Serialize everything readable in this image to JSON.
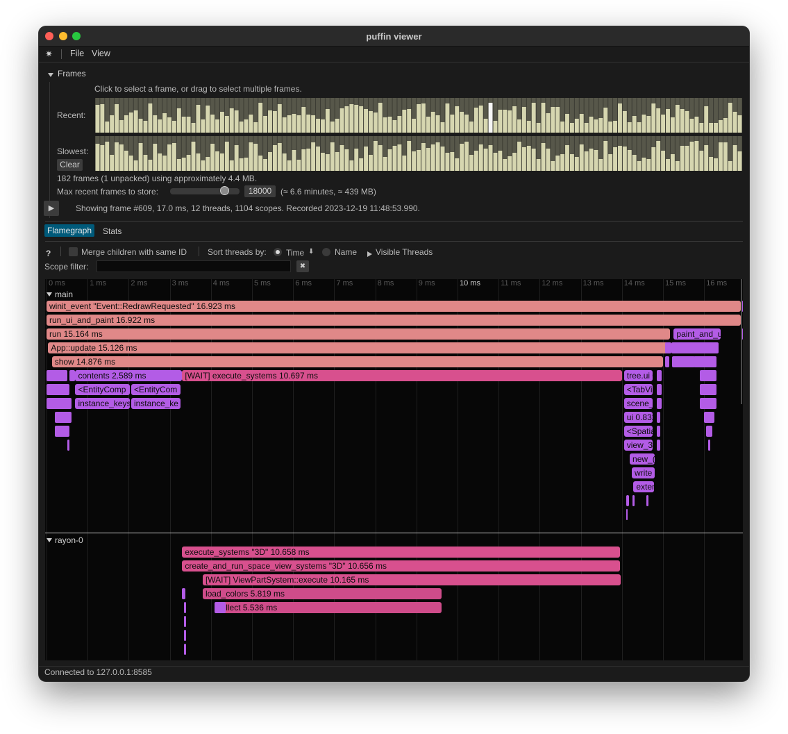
{
  "window": {
    "title": "puffin viewer"
  },
  "menu": {
    "logo": "✷",
    "file": "File",
    "view": "View"
  },
  "frames": {
    "header": "Frames",
    "hint": "Click to select a frame, or drag to select multiple frames.",
    "recent_label": "Recent:",
    "slowest_label": "Slowest:",
    "clear_label": "Clear",
    "summary": "182 frames (1 unpacked) using approximately 4.4 MB.",
    "max_label": "Max recent frames to store:",
    "max_value": "18000",
    "max_estimate": "(≈ 6.6 minutes, ≈ 439 MB)",
    "slider_fraction": 0.78,
    "play_icon": "▶",
    "status": "Showing frame #609, 17.0 ms, 12 threads, 1104 scopes. Recorded 2023-12-19 11:48:53.990."
  },
  "tabs": {
    "flamegraph": "Flamegraph",
    "stats": "Stats"
  },
  "options": {
    "help": "?",
    "merge_label": "Merge children with same ID",
    "sort_label": "Sort threads by:",
    "time_label": "Time",
    "sort_arrow": "⬇",
    "name_label": "Name",
    "visible_threads": "Visible Threads",
    "scope_filter_label": "Scope filter:",
    "clear_filter_icon": "✖"
  },
  "timeline": {
    "ticks": [
      "0 ms",
      "1 ms",
      "2 ms",
      "3 ms",
      "4 ms",
      "5 ms",
      "6 ms",
      "7 ms",
      "8 ms",
      "9 ms",
      "10 ms",
      "11 ms",
      "12 ms",
      "13 ms",
      "14 ms",
      "15 ms",
      "16 ms"
    ]
  },
  "threads": [
    {
      "name": "main",
      "scopes": [
        {
          "label": "winit_event \"Event::RedrawRequested\" 16.923 ms",
          "start": 0.0,
          "dur": 16.923,
          "depth": 0,
          "color": "#e08888"
        },
        {
          "label": "run_ui_and_paint 16.922 ms",
          "start": 0.0,
          "dur": 16.922,
          "depth": 1,
          "color": "#e08888"
        },
        {
          "label": "run 15.164 ms",
          "start": 0.0,
          "dur": 15.164,
          "depth": 2,
          "color": "#e08888"
        },
        {
          "label": "paint_and_u",
          "start": 15.26,
          "dur": 1.15,
          "depth": 2,
          "color": "#b35ce6"
        },
        {
          "label": "App::update 15.126 ms",
          "start": 0.04,
          "dur": 15.126,
          "depth": 3,
          "color": "#e08888"
        },
        {
          "label": "show 14.876 ms",
          "start": 0.13,
          "dur": 14.876,
          "depth": 4,
          "color": "#e08888"
        },
        {
          "label": "contents  2.589 ms",
          "start": 0.7,
          "dur": 2.589,
          "depth": 5,
          "color": "#b35ce6"
        },
        {
          "label": "[WAIT] execute_systems 10.697 ms",
          "start": 3.3,
          "dur": 10.697,
          "depth": 5,
          "color": "#d8508e"
        },
        {
          "label": "tree.ui  0.",
          "start": 14.05,
          "dur": 0.7,
          "depth": 5,
          "color": "#b35ce6"
        },
        {
          "label": "<EntityComp",
          "start": 0.7,
          "dur": 1.33,
          "depth": 6,
          "color": "#b35ce6"
        },
        {
          "label": "<EntityCom",
          "start": 2.06,
          "dur": 1.2,
          "depth": 6,
          "color": "#b35ce6"
        },
        {
          "label": "<TabVie",
          "start": 14.05,
          "dur": 0.7,
          "depth": 6,
          "color": "#b35ce6"
        },
        {
          "label": "instance_keys",
          "start": 0.7,
          "dur": 1.33,
          "depth": 7,
          "color": "#b35ce6"
        },
        {
          "label": "instance_ke",
          "start": 2.06,
          "dur": 1.2,
          "depth": 7,
          "color": "#b35ce6"
        },
        {
          "label": "scene_u",
          "start": 14.05,
          "dur": 0.7,
          "depth": 7,
          "color": "#b35ce6"
        },
        {
          "label": "ui  0.832",
          "start": 14.05,
          "dur": 0.7,
          "depth": 8,
          "color": "#b35ce6"
        },
        {
          "label": "<Spatial",
          "start": 14.05,
          "dur": 0.7,
          "depth": 9,
          "color": "#b35ce6"
        },
        {
          "label": "view_3d",
          "start": 14.05,
          "dur": 0.7,
          "depth": 10,
          "color": "#b35ce6"
        },
        {
          "label": "new_(",
          "start": 14.19,
          "dur": 0.6,
          "depth": 11,
          "color": "#b35ce6"
        },
        {
          "label": "write",
          "start": 14.24,
          "dur": 0.55,
          "depth": 12,
          "color": "#b35ce6"
        },
        {
          "label": "exten",
          "start": 14.28,
          "dur": 0.5,
          "depth": 13,
          "color": "#b35ce6"
        }
      ]
    },
    {
      "name": "rayon-0",
      "scopes": [
        {
          "label": "execute_systems \"3D\" 10.658 ms",
          "start": 3.3,
          "dur": 10.658,
          "depth": 0,
          "color": "#d8508e"
        },
        {
          "label": "create_and_run_space_view_systems \"3D\" 10.656 ms",
          "start": 3.3,
          "dur": 10.656,
          "depth": 1,
          "color": "#d8508e"
        },
        {
          "label": "[WAIT] ViewPartSystem::execute 10.165 ms",
          "start": 3.8,
          "dur": 10.165,
          "depth": 2,
          "color": "#d8508e"
        },
        {
          "label": "load_colors  5.819 ms",
          "start": 3.8,
          "dur": 5.819,
          "depth": 3,
          "color": "#cf4c8a"
        },
        {
          "label": "collect  5.536 ms",
          "start": 4.08,
          "dur": 5.536,
          "depth": 4,
          "color": "#cf4c8a"
        }
      ]
    }
  ],
  "status_bar": "Connected to 127.0.0.1:8585"
}
